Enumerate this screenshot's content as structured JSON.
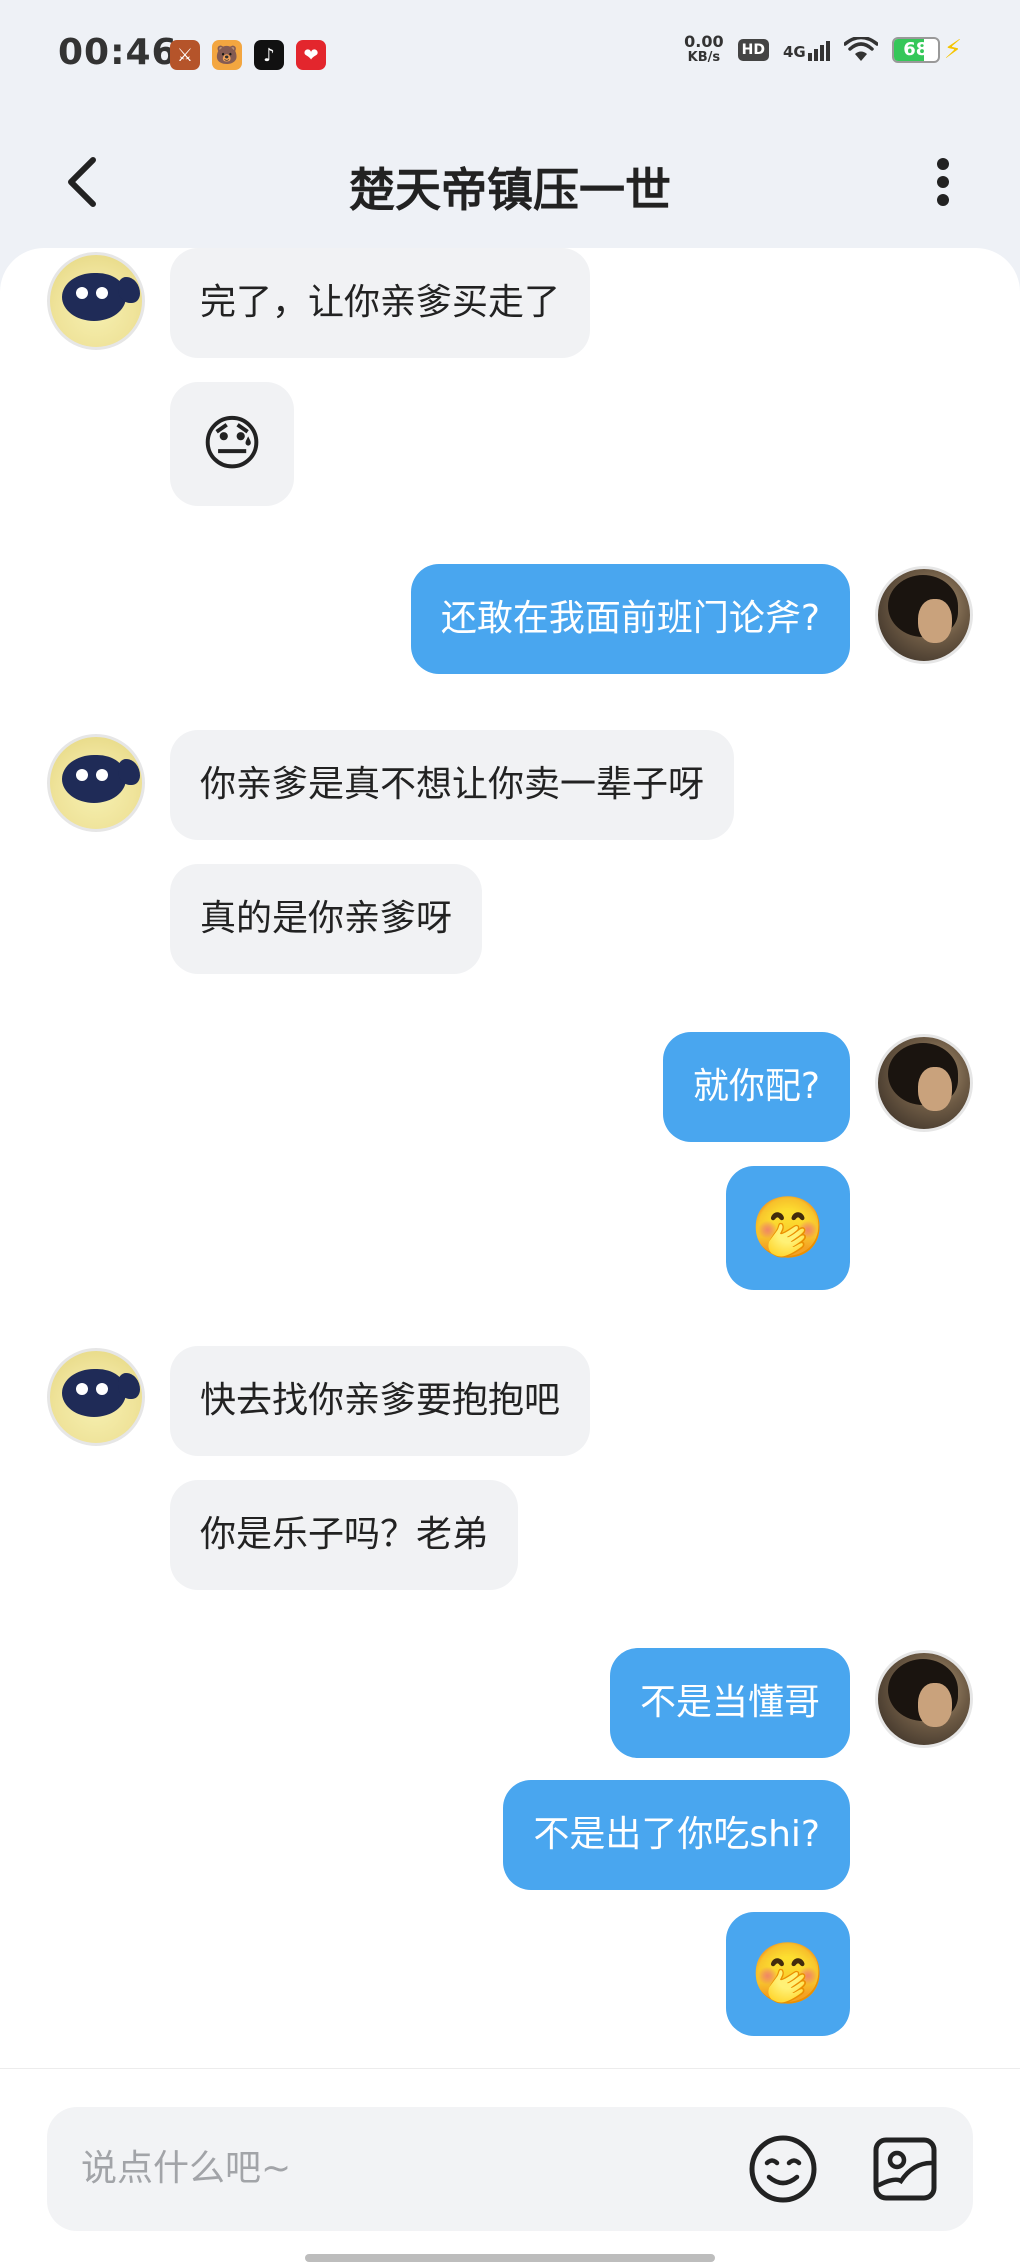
{
  "status_bar": {
    "time": "00:46",
    "net_speed_value": "0.00",
    "net_speed_unit": "KB/s",
    "hd": "HD",
    "network": "4G",
    "battery": "68",
    "battery_level_percent": 68,
    "app_icons": [
      "game-app-icon",
      "bear-app-icon",
      "tiktok-icon",
      "red-app-icon"
    ]
  },
  "header": {
    "title": "楚天帝镇压一世"
  },
  "messages": [
    {
      "side": "left",
      "type": "text",
      "text": "完了，让你亲爹买走了"
    },
    {
      "side": "left",
      "type": "emoji",
      "text": "😓"
    },
    {
      "side": "right",
      "type": "text",
      "text": "还敢在我面前班门论斧?"
    },
    {
      "side": "left",
      "type": "text",
      "text": "你亲爹是真不想让你卖一辈子呀"
    },
    {
      "side": "left",
      "type": "text",
      "text": "真的是你亲爹呀"
    },
    {
      "side": "right",
      "type": "text",
      "text": "就你配?"
    },
    {
      "side": "right",
      "type": "emoji",
      "text": "🤭"
    },
    {
      "side": "left",
      "type": "text",
      "text": "快去找你亲爹要抱抱吧"
    },
    {
      "side": "left",
      "type": "text",
      "text": "你是乐子吗？老弟"
    },
    {
      "side": "right",
      "type": "text",
      "text": "不是当懂哥"
    },
    {
      "side": "right",
      "type": "text",
      "text": "不是出了你吃shi?"
    },
    {
      "side": "right",
      "type": "emoji",
      "text": "🤭"
    }
  ],
  "input": {
    "placeholder": "说点什么吧~"
  },
  "colors": {
    "sent_bubble": "#49a6ef",
    "received_bubble": "#f1f2f4",
    "background": "#eef1f6"
  }
}
